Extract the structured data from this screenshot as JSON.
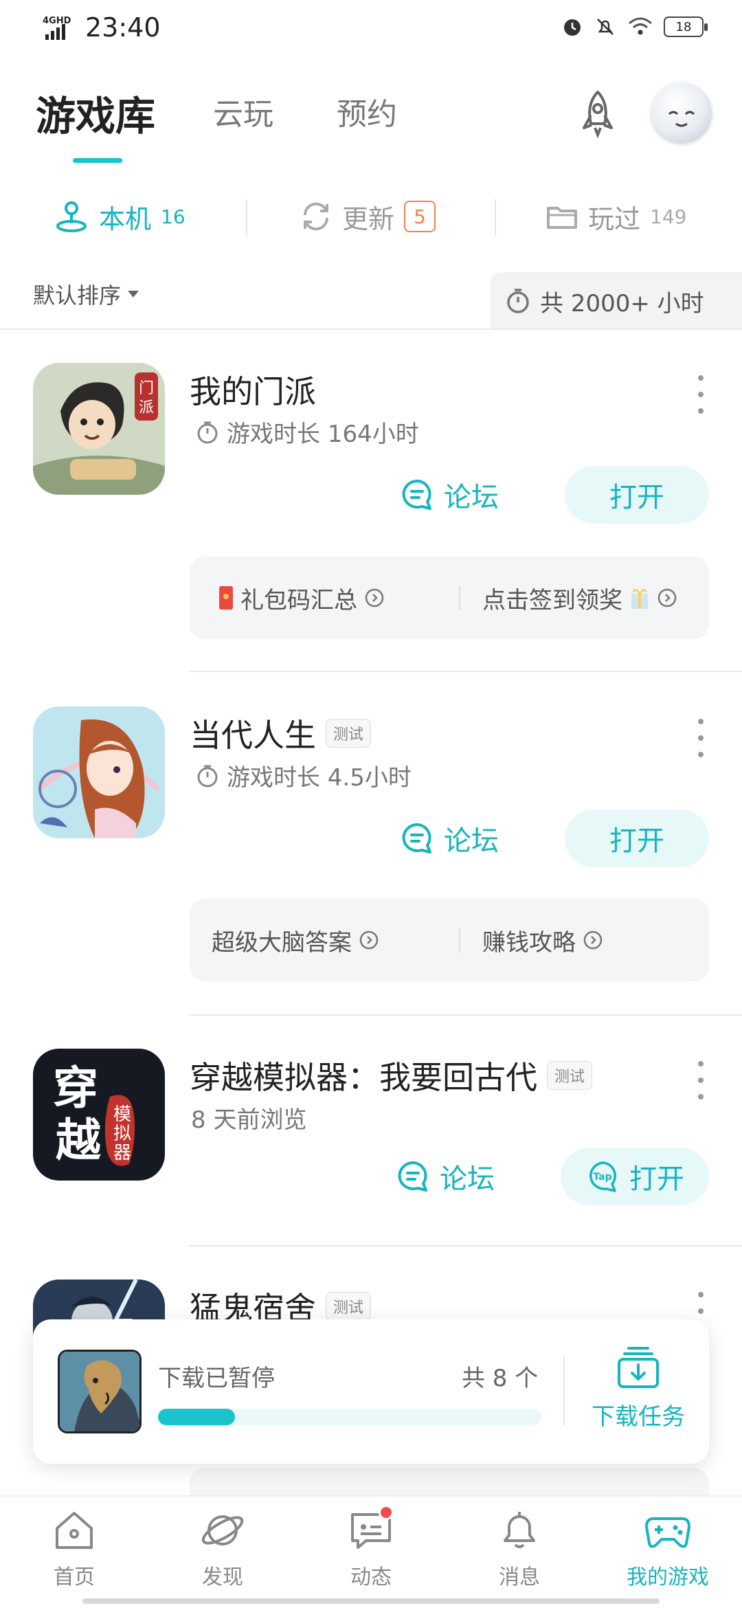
{
  "status_bar": {
    "network": "4GHD",
    "time": "23:40",
    "battery": "18"
  },
  "top_tabs": [
    {
      "label": "游戏库"
    },
    {
      "label": "云玩"
    },
    {
      "label": "预约"
    }
  ],
  "sub_tabs": {
    "local": {
      "label": "本机",
      "count": "16"
    },
    "update": {
      "label": "更新",
      "count": "5"
    },
    "played": {
      "label": "玩过",
      "count": "149"
    }
  },
  "sort": {
    "label": "默认排序"
  },
  "total_time": "共 2000+ 小时",
  "games": [
    {
      "title": "我的门派",
      "tag": "",
      "meta": "游戏时长 164小时",
      "forum_label": "论坛",
      "open_label": "打开",
      "links": [
        {
          "label": "礼包码汇总"
        },
        {
          "label": "点击签到领奖"
        }
      ]
    },
    {
      "title": "当代人生",
      "tag": "测试",
      "meta": "游戏时长 4.5小时",
      "forum_label": "论坛",
      "open_label": "打开",
      "links": [
        {
          "label": "超级大脑答案"
        },
        {
          "label": "赚钱攻略"
        }
      ]
    },
    {
      "title": "穿越模拟器：我要回古代",
      "tag": "测试",
      "meta": "8 天前浏览",
      "forum_label": "论坛",
      "open_label": "打开"
    },
    {
      "title": "猛鬼宿舍",
      "tag": "测试"
    }
  ],
  "download": {
    "status": "下载已暂停",
    "count": "共 8 个",
    "progress": 0.2,
    "task_label": "下载任务"
  },
  "bottom_nav": [
    {
      "label": "首页",
      "icon": "home-icon"
    },
    {
      "label": "发现",
      "icon": "planet-icon"
    },
    {
      "label": "动态",
      "icon": "chat-icon"
    },
    {
      "label": "消息",
      "icon": "bell-icon"
    },
    {
      "label": "我的游戏",
      "icon": "gamepad-icon"
    }
  ],
  "colors": {
    "accent": "#15b5be",
    "update_badge": "#f0834b",
    "notification_dot": "#f04a4a"
  }
}
